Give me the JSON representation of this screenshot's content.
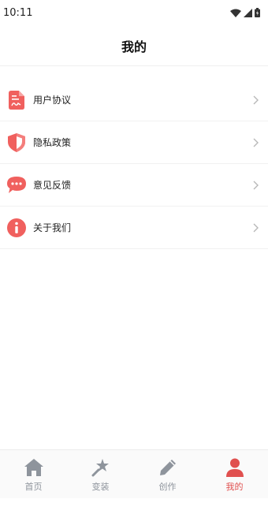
{
  "status_bar": {
    "time": "10:11",
    "icons": [
      "wifi-icon",
      "signal-icon",
      "battery-icon"
    ]
  },
  "header": {
    "title": "我的"
  },
  "menu": {
    "items": [
      {
        "label": "用户协议",
        "icon": "document-icon"
      },
      {
        "label": "隐私政策",
        "icon": "shield-icon"
      },
      {
        "label": "意见反馈",
        "icon": "chat-bubble-icon"
      },
      {
        "label": "关于我们",
        "icon": "info-icon"
      }
    ]
  },
  "bottom_nav": {
    "items": [
      {
        "label": "首页",
        "icon": "home-icon",
        "active": false
      },
      {
        "label": "变装",
        "icon": "magic-wand-icon",
        "active": false
      },
      {
        "label": "创作",
        "icon": "pencil-icon",
        "active": false
      },
      {
        "label": "我的",
        "icon": "user-icon",
        "active": true
      }
    ]
  },
  "colors": {
    "accent": "#f0605e",
    "active_tab": "#e0504f",
    "inactive_tab": "#8e949c"
  }
}
